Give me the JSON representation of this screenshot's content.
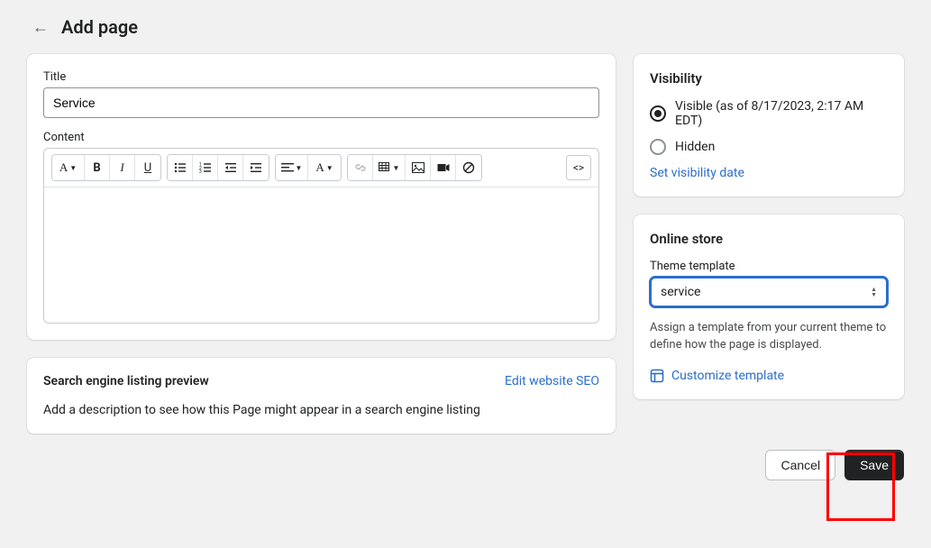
{
  "header": {
    "title": "Add page"
  },
  "main": {
    "title_label": "Title",
    "title_value": "Service",
    "content_label": "Content"
  },
  "seo": {
    "title": "Search engine listing preview",
    "edit_link": "Edit website SEO",
    "description": "Add a description to see how this Page might appear in a search engine listing"
  },
  "visibility": {
    "title": "Visibility",
    "visible_label": "Visible (as of 8/17/2023, 2:17 AM EDT)",
    "hidden_label": "Hidden",
    "set_date_link": "Set visibility date"
  },
  "online_store": {
    "title": "Online store",
    "template_label": "Theme template",
    "template_value": "service",
    "helper": "Assign a template from your current theme to define how the page is displayed.",
    "customize_link": "Customize template"
  },
  "footer": {
    "cancel": "Cancel",
    "save": "Save"
  }
}
